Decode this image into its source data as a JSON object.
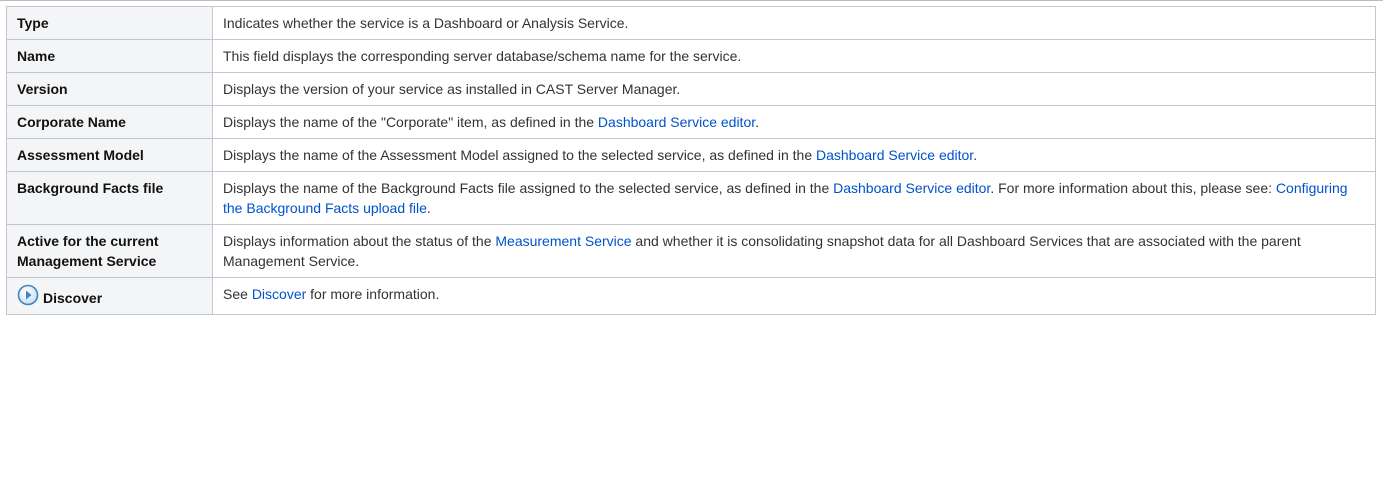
{
  "rows": [
    {
      "key": "Type",
      "parts": [
        {
          "text": "Indicates whether the service is a Dashboard or Analysis Service."
        }
      ]
    },
    {
      "key": "Name",
      "parts": [
        {
          "text": "This field displays the corresponding server database/schema name for the service."
        }
      ]
    },
    {
      "key": "Version",
      "parts": [
        {
          "text": "Displays the version of your service as installed in CAST Server Manager."
        }
      ]
    },
    {
      "key": "Corporate Name",
      "parts": [
        {
          "text": "Displays the name of the \"Corporate\" item, as defined in the "
        },
        {
          "text": "Dashboard Service editor",
          "link": true
        },
        {
          "text": "."
        }
      ]
    },
    {
      "key": "Assessment Model",
      "parts": [
        {
          "text": "Displays the name of the Assessment Model assigned to the selected service, as defined in the "
        },
        {
          "text": "Dashboard Service editor",
          "link": true
        },
        {
          "text": "."
        }
      ]
    },
    {
      "key": "Background Facts file",
      "parts": [
        {
          "text": "Displays the name of the Background Facts file assigned to the selected service, as defined in the "
        },
        {
          "text": "Dashboard Service editor",
          "link": true
        },
        {
          "text": ". For more information about this, please see: "
        },
        {
          "text": "Configuring the Background Facts upload file",
          "link": true
        },
        {
          "text": "."
        }
      ]
    },
    {
      "key": "Active for the current Management Service",
      "parts": [
        {
          "text": "Displays information about the status of the "
        },
        {
          "text": "Measurement Service",
          "link": true
        },
        {
          "text": " and whether it is consolidating snapshot data for all Dashboard Services that are associated with the parent Management Service."
        }
      ]
    },
    {
      "key": "Discover",
      "icon": "play-circle-icon",
      "parts": [
        {
          "text": "See "
        },
        {
          "text": "Discover",
          "link": true
        },
        {
          "text": " for more information."
        }
      ]
    }
  ],
  "colors": {
    "link": "#0052cc",
    "header_bg": "#f4f5f7",
    "border": "#c1c7d0",
    "icon_blue": "#3d84c6"
  }
}
